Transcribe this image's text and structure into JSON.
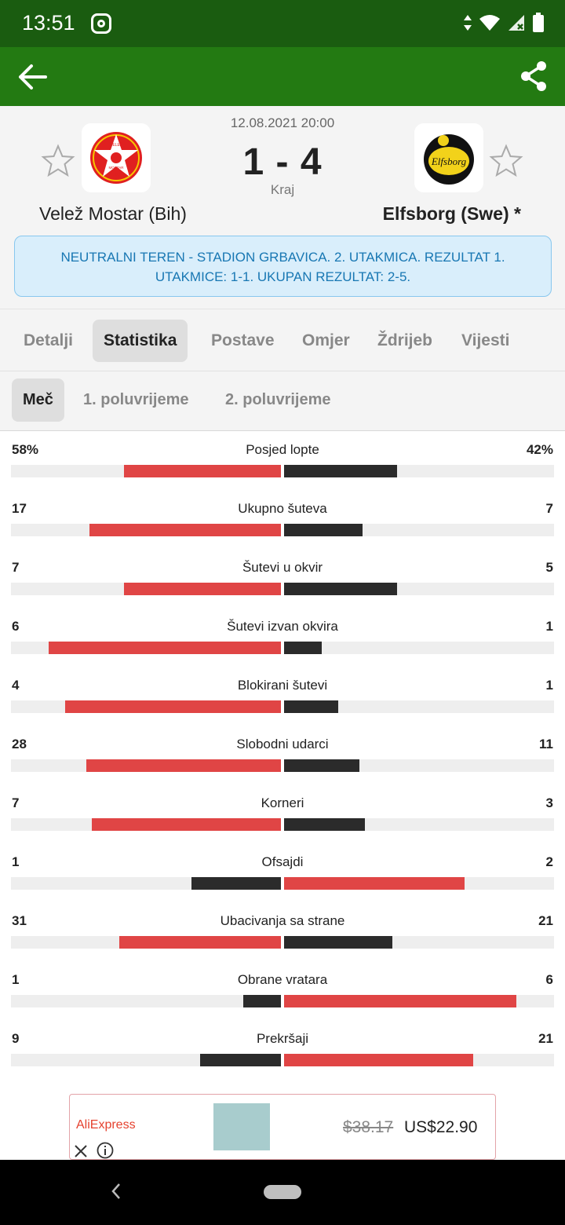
{
  "status_bar": {
    "time": "13:51"
  },
  "match": {
    "date": "12.08.2021 20:00",
    "score": "1 - 4",
    "status": "Kraj",
    "home_team": "Velež Mostar (Bih)",
    "away_team": "Elfsborg (Swe) *",
    "home_logo_text_top": "VELEŽ",
    "home_logo_text_bottom": "MOSTAR",
    "home_logo_year": "1922",
    "away_logo_text": "Elfsborg"
  },
  "info_banner": "NEUTRALNI TEREN - STADION GRBAVICA. 2. UTAKMICA. REZULTAT 1. UTAKMICE: 1-1. UKUPAN REZULTAT: 2-5.",
  "tabs": [
    {
      "label": "Detalji"
    },
    {
      "label": "Statistika",
      "active": true
    },
    {
      "label": "Postave"
    },
    {
      "label": "Omjer"
    },
    {
      "label": "Ždrijeb"
    },
    {
      "label": "Vijesti"
    }
  ],
  "subtabs": [
    {
      "label": "Meč",
      "active": true
    },
    {
      "label": "1. poluvrijeme"
    },
    {
      "label": "2. poluvrijeme"
    }
  ],
  "colors": {
    "leader": "#e04545",
    "trailer": "#2b2b2b",
    "header_green": "#237a12"
  },
  "stats": [
    {
      "name": "Posjed lopte",
      "home": "58%",
      "away": "42%",
      "home_frac": 0.58,
      "away_frac": 0.42
    },
    {
      "name": "Ukupno šuteva",
      "home": "17",
      "away": "7",
      "home_frac": 0.71,
      "away_frac": 0.29
    },
    {
      "name": "Šutevi u okvir",
      "home": "7",
      "away": "5",
      "home_frac": 0.58,
      "away_frac": 0.42
    },
    {
      "name": "Šutevi izvan okvira",
      "home": "6",
      "away": "1",
      "home_frac": 0.86,
      "away_frac": 0.14
    },
    {
      "name": "Blokirani šutevi",
      "home": "4",
      "away": "1",
      "home_frac": 0.8,
      "away_frac": 0.2
    },
    {
      "name": "Slobodni udarci",
      "home": "28",
      "away": "11",
      "home_frac": 0.72,
      "away_frac": 0.28
    },
    {
      "name": "Korneri",
      "home": "7",
      "away": "3",
      "home_frac": 0.7,
      "away_frac": 0.3
    },
    {
      "name": "Ofsajdi",
      "home": "1",
      "away": "2",
      "home_frac": 0.33,
      "away_frac": 0.67
    },
    {
      "name": "Ubacivanja sa strane",
      "home": "31",
      "away": "21",
      "home_frac": 0.6,
      "away_frac": 0.4
    },
    {
      "name": "Obrane vratara",
      "home": "1",
      "away": "6",
      "home_frac": 0.14,
      "away_frac": 0.86
    },
    {
      "name": "Prekršaji",
      "home": "9",
      "away": "21",
      "home_frac": 0.3,
      "away_frac": 0.7
    }
  ],
  "ad": {
    "brand": "AliExpress",
    "old_price": "$38.17",
    "price": "US$22.90"
  }
}
